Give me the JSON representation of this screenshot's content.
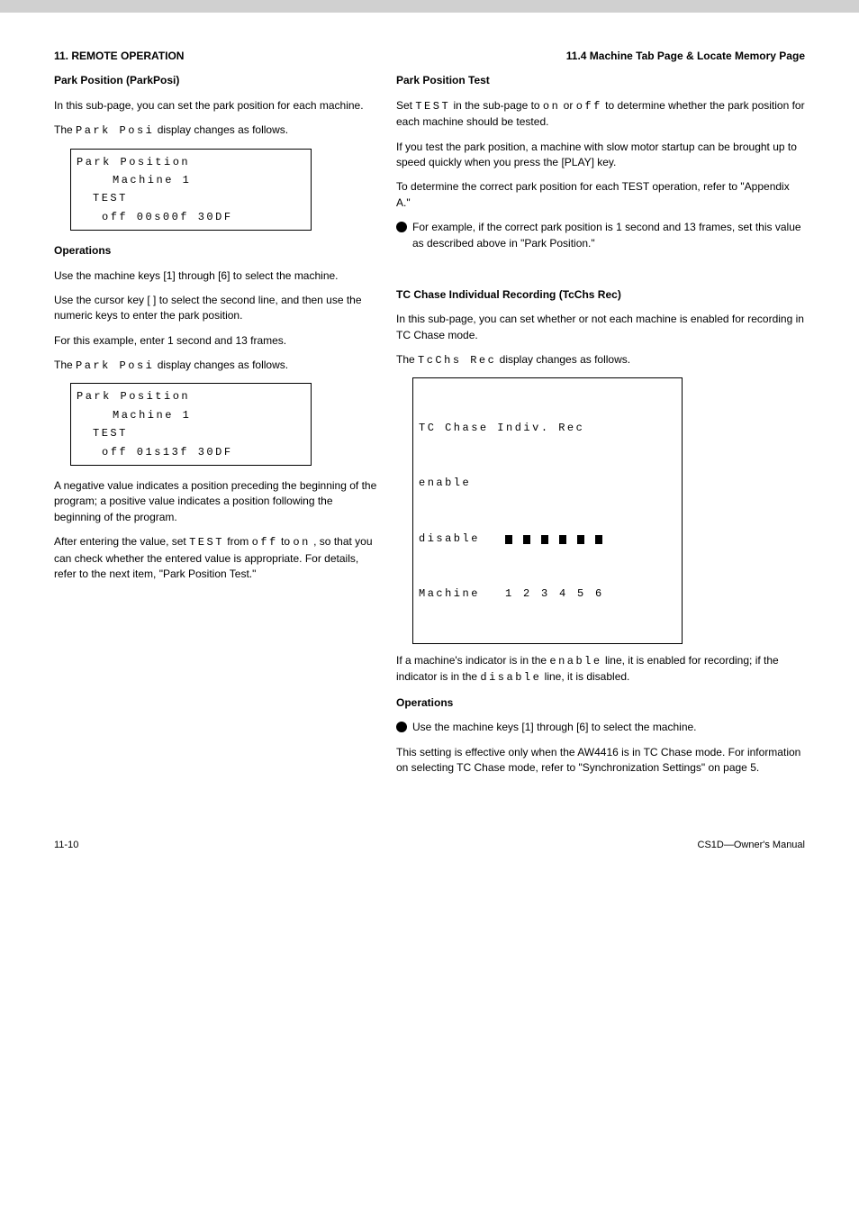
{
  "header": {
    "left_title": "11. REMOTE OPERATION",
    "right_title": "11.4 Machine Tab Page & Locate Memory Page"
  },
  "col_left": {
    "sec1": {
      "title": "Park Position (ParkPosi)",
      "intro": "In this sub-page, you can set the park position for each machine.",
      "display_label": "Park\nPosi",
      "before_text": "The",
      "after_text": " display changes as follows.",
      "box": {
        "l1": "Park Position",
        "l2": "Machine  1",
        "l3": "TEST",
        "l4": "off   00s00f 30DF"
      },
      "ops": {
        "heading": "Operations",
        "row1": "Use the machine keys [1] through [6] to select the machine.",
        "row2_a": "Use the cursor key [ ] to select the second line, and then use the numeric keys to enter the park position.",
        "row2_b": "For this example, enter 1 second and 13 frames."
      },
      "display_label2": "Park\nPosi",
      "before_text2": "The",
      "after_text2": " display changes as follows.",
      "box2": {
        "l1": "Park Position",
        "l2": "Machine  1",
        "l3": "TEST",
        "l4": "off   01s13f 30DF"
      },
      "note": "A negative value indicates a position preceding the beginning of the program; a positive value indicates a position following the beginning of the program.",
      "row3_a": "After entering the value, set ",
      "row3_mono": "TEST",
      "row3_b": " from ",
      "row3_off": "off",
      "row3_c": " to ",
      "row3_on": "on",
      "row3_d": ", so that you can check whether the entered value is appropriate. For details, refer to the next item, \"Park Position Test.\""
    }
  },
  "col_right": {
    "sec2": {
      "title": "Park Position Test",
      "p1_a": "Set ",
      "p1_mono": "TEST",
      "p1_b": " in the sub-page to ",
      "p1_on": "on",
      "p1_c": " or ",
      "p1_off": "off",
      "p1_d": " to determine whether the park position for each machine should be tested.",
      "p2": "If you test the park position, a machine with slow motor startup can be brought up to speed quickly when you press the [PLAY] key.",
      "p3": "To determine the correct park position for each TEST operation, refer to \"Appendix A.\"",
      "bullet": "For example, if the correct park position is 1 second and 13 frames, set this value as described above in \"Park Position.\""
    },
    "sec3": {
      "title": "TC Chase Individual Recording (TcChs Rec)",
      "intro": "In this sub-page, you can set whether or not each machine is enabled for recording in TC Chase mode.",
      "display_label": "TcChs Rec",
      "after_text": " display changes as follows.",
      "tcbox": {
        "l1": "TC Chase Indiv. Rec",
        "l2": "enable",
        "l3_label": "disable",
        "l4_label": "Machine",
        "machines": [
          "1",
          "2",
          "3",
          "4",
          "5",
          "6"
        ]
      },
      "p_after_a": "If a machine's indicator is in the ",
      "p_enable": "enable",
      "p_after_b": " line, it is enabled for recording; if the indicator is in the ",
      "p_disable": "disable",
      "p_after_c": " line, it is disabled.",
      "ops_heading": "Operations",
      "bullet": "Use the machine keys [1] through [6] to select the machine.",
      "note": "This setting is effective only when the AW4416 is in TC Chase mode. For information on selecting TC Chase mode, refer to \"Synchronization Settings\" on page 5."
    }
  },
  "footer": {
    "left": "11-10",
    "right": "CS1D—Owner's Manual"
  }
}
